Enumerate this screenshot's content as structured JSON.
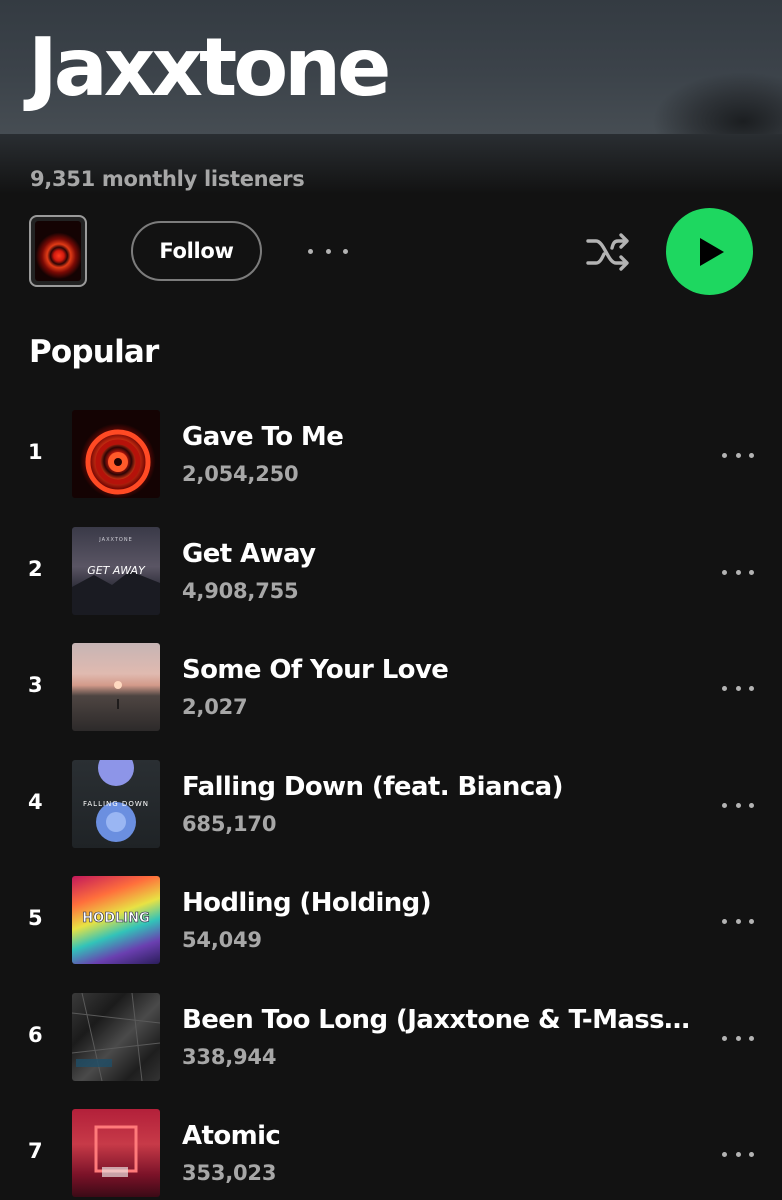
{
  "header": {
    "artist_name": "Jaxxtone",
    "monthly_listeners": "9,351 monthly listeners"
  },
  "actions": {
    "follow_label": "Follow",
    "more_icon": "more-horizontal-icon",
    "shuffle_icon": "shuffle-icon",
    "play_icon": "play-icon",
    "play_color": "#1ed760"
  },
  "popular": {
    "title": "Popular",
    "tracks": [
      {
        "rank": "1",
        "title": "Gave To Me",
        "plays": "2,054,250"
      },
      {
        "rank": "2",
        "title": "Get Away",
        "plays": "4,908,755",
        "cover_text": "GET AWAY",
        "cover_artist": "JAXXTONE"
      },
      {
        "rank": "3",
        "title": "Some Of Your Love",
        "plays": "2,027"
      },
      {
        "rank": "4",
        "title": "Falling Down (feat. Bianca)",
        "plays": "685,170",
        "cover_text": "FALLING DOWN"
      },
      {
        "rank": "5",
        "title": "Hodling (Holding)",
        "plays": "54,049",
        "cover_text": "HODLING"
      },
      {
        "rank": "6",
        "title": "Been Too Long (Jaxxtone & T-Mass R...",
        "plays": "338,944"
      },
      {
        "rank": "7",
        "title": "Atomic",
        "plays": "353,023"
      }
    ]
  }
}
